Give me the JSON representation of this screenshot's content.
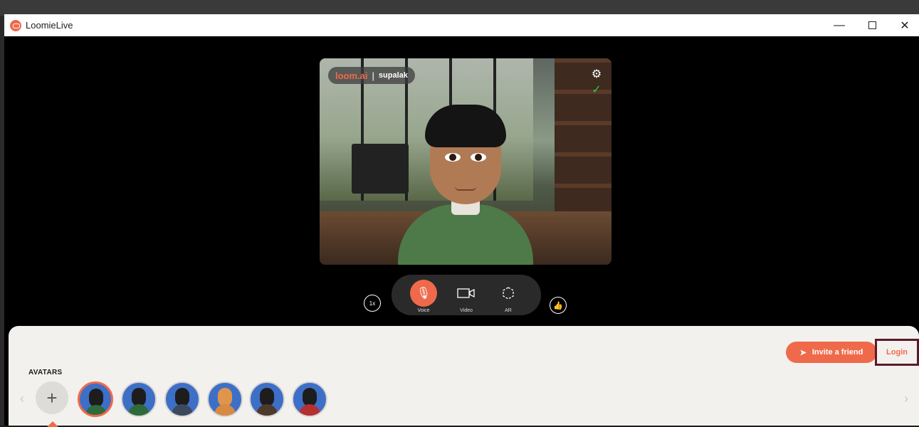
{
  "window": {
    "title": "LoomieLive",
    "controls": {
      "minimize": "—",
      "maximize": "",
      "close": "✕"
    }
  },
  "video": {
    "brand_logo": "loom.ai",
    "separator": "|",
    "username": "supalak",
    "settings_icon": "gear-icon",
    "status_icon": "check-icon"
  },
  "controls": {
    "speed": "1x",
    "items": [
      {
        "label": "Voice",
        "icon": "microphone-icon",
        "active": true
      },
      {
        "label": "Video",
        "icon": "video-camera-icon",
        "active": false
      },
      {
        "label": "AR",
        "icon": "ar-cube-icon",
        "active": false
      }
    ],
    "like_icon": "thumbs-up-icon"
  },
  "panel": {
    "invite_label": "Invite a friend",
    "login_label": "Login",
    "avatars_label": "AVATARS",
    "add_symbol": "+",
    "prev_symbol": "‹",
    "next_symbol": "›",
    "selected_avatar_index": 0,
    "avatar_count": 6
  },
  "colors": {
    "accent": "#ef6a4b",
    "panel_bg": "#f3f1ee",
    "login_border": "#5a1a2c"
  }
}
